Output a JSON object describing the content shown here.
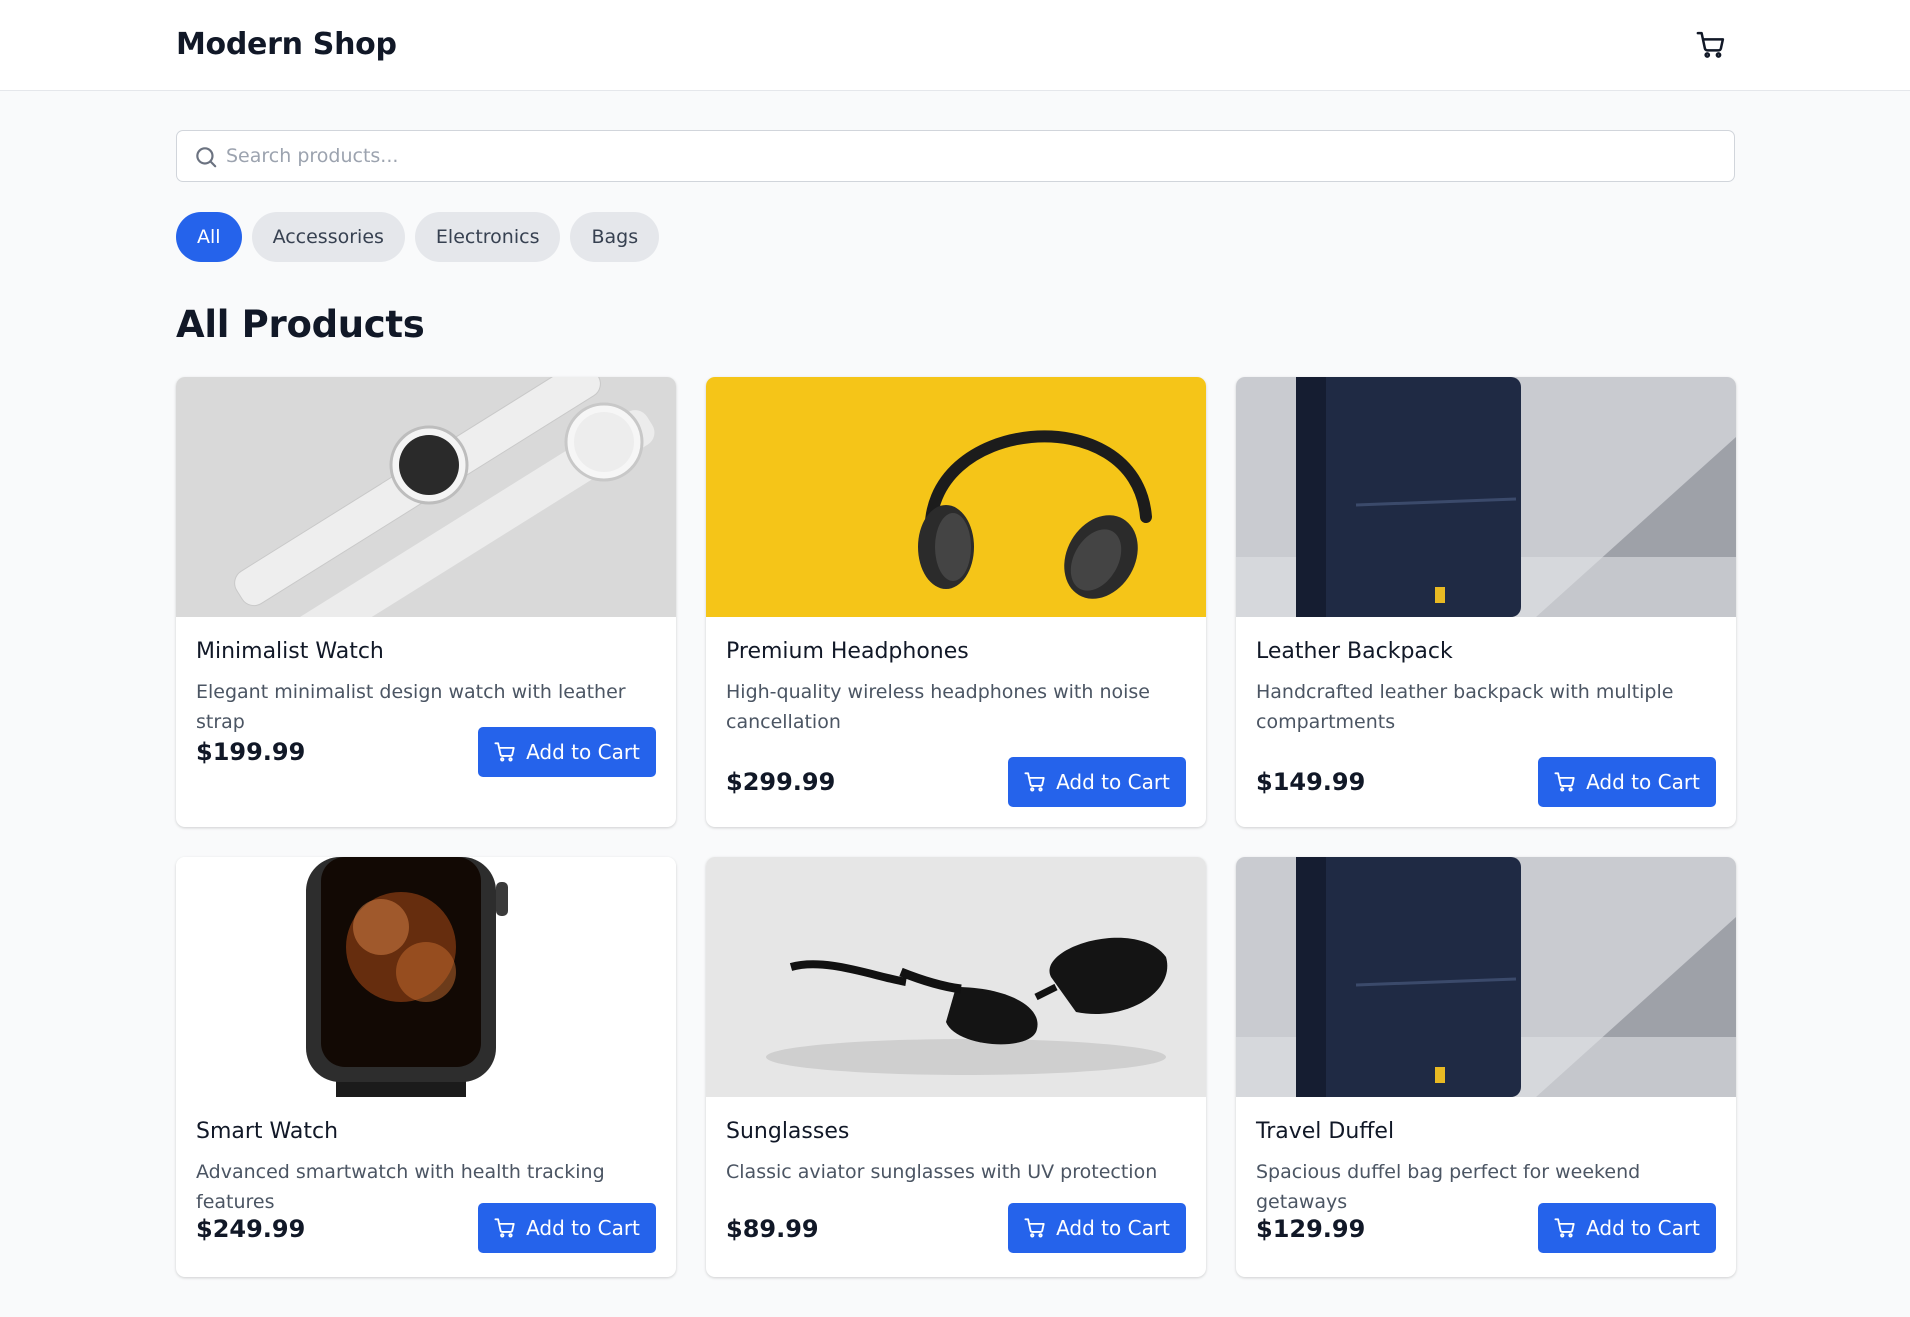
{
  "header": {
    "brand": "Modern Shop",
    "cart_icon": "shopping-cart-icon"
  },
  "search": {
    "placeholder": "Search products...",
    "value": "",
    "icon": "search-icon"
  },
  "filters": [
    {
      "label": "All",
      "active": true
    },
    {
      "label": "Accessories",
      "active": false
    },
    {
      "label": "Electronics",
      "active": false
    },
    {
      "label": "Bags",
      "active": false
    }
  ],
  "section": {
    "title": "All Products"
  },
  "products": [
    {
      "name": "Minimalist Watch",
      "description": "Elegant minimalist design watch with leather strap",
      "price": "$199.99",
      "button": "Add to Cart"
    },
    {
      "name": "Premium Headphones",
      "description": "High-quality wireless headphones with noise cancellation",
      "price": "$299.99",
      "button": "Add to Cart"
    },
    {
      "name": "Leather Backpack",
      "description": "Handcrafted leather backpack with multiple compartments",
      "price": "$149.99",
      "button": "Add to Cart"
    },
    {
      "name": "Smart Watch",
      "description": "Advanced smartwatch with health tracking features",
      "price": "$249.99",
      "button": "Add to Cart"
    },
    {
      "name": "Sunglasses",
      "description": "Classic aviator sunglasses with UV protection",
      "price": "$89.99",
      "button": "Add to Cart"
    },
    {
      "name": "Travel Duffel",
      "description": "Spacious duffel bag perfect for weekend getaways",
      "price": "$129.99",
      "button": "Add to Cart"
    }
  ],
  "colors": {
    "accent": "#2563eb",
    "page_bg": "#f9fafb",
    "chip_bg": "#e5e7eb"
  }
}
